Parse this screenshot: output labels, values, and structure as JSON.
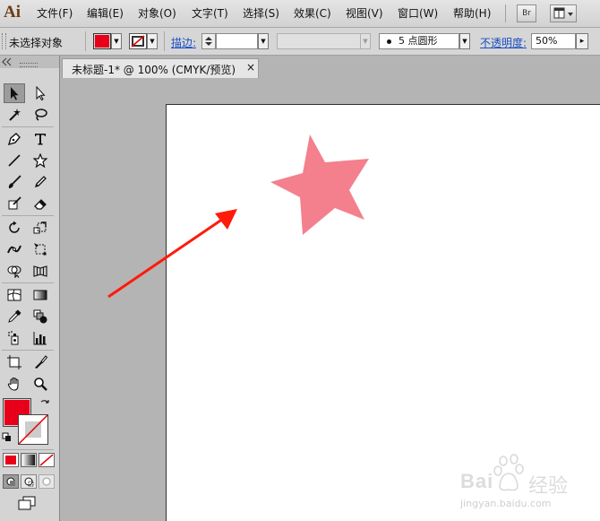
{
  "app": {
    "logo_text": "Ai"
  },
  "menubar": {
    "items": [
      {
        "label": "文件(F)"
      },
      {
        "label": "编辑(E)"
      },
      {
        "label": "对象(O)"
      },
      {
        "label": "文字(T)"
      },
      {
        "label": "选择(S)"
      },
      {
        "label": "效果(C)"
      },
      {
        "label": "视图(V)"
      },
      {
        "label": "窗口(W)"
      },
      {
        "label": "帮助(H)"
      }
    ],
    "bridge_label": "Br"
  },
  "controlbar": {
    "selection_status": "未选择对象",
    "fill_color": "#e8001a",
    "stroke_label": "描边:",
    "brush_value": "5 点圆形",
    "opacity_label": "不透明度:",
    "opacity_value": "50%"
  },
  "document": {
    "tab_title": "未标题-1* @ 100% (CMYK/预览)",
    "close_symbol": "×"
  },
  "canvas": {
    "star_color": "#f4808d",
    "arrow_color": "#ff1a0a"
  },
  "toolbar": {
    "fill_color": "#e8001a",
    "tools": [
      "selection-tool",
      "direct-selection-tool",
      "magic-wand-tool",
      "lasso-tool",
      "pen-tool",
      "type-tool",
      "line-segment-tool",
      "star-tool",
      "paintbrush-tool",
      "pencil-tool",
      "blob-brush-tool",
      "eraser-tool",
      "rotate-tool",
      "scale-tool",
      "width-tool",
      "free-transform-tool",
      "shape-builder-tool",
      "perspective-grid-tool",
      "mesh-tool",
      "gradient-tool",
      "eyedropper-tool",
      "blend-tool",
      "symbol-sprayer-tool",
      "column-graph-tool",
      "artboard-tool",
      "slice-tool",
      "hand-tool",
      "zoom-tool"
    ]
  },
  "watermark": {
    "brand_text": "Bai",
    "brand_cn": "经验",
    "url": "jingyan.baidu.com"
  }
}
